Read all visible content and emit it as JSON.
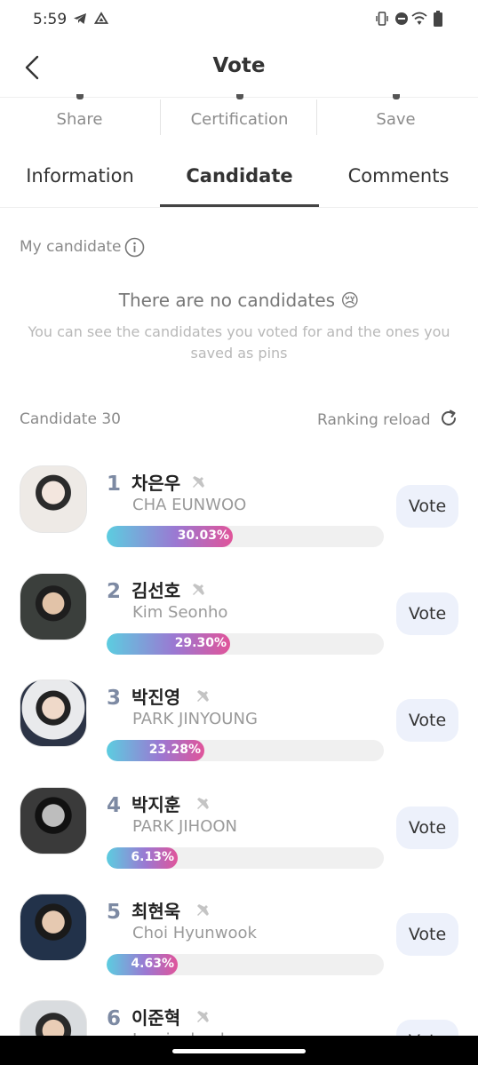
{
  "status_bar": {
    "time": "5:59"
  },
  "header": {
    "title": "Vote"
  },
  "actions": [
    {
      "label": "Share"
    },
    {
      "label": "Certification"
    },
    {
      "label": "Save"
    }
  ],
  "tabs": [
    {
      "label": "Information"
    },
    {
      "label": "Candidate"
    },
    {
      "label": "Comments"
    }
  ],
  "my_candidate": {
    "label": "My candidate",
    "empty_title": "There are no candidates 😢",
    "empty_desc": "You can see the candidates you voted for and the ones you saved as pins"
  },
  "list_header": {
    "count_label": "Candidate 30",
    "reload_label": "Ranking reload"
  },
  "vote_label": "Vote",
  "colors": {
    "bar_gradient_start": "#5ccde0",
    "bar_gradient_mid": "#9b78d2",
    "bar_gradient_end": "#e0549a",
    "vote_button_bg": "#edf1fb",
    "rank_color": "#7d8aa3"
  },
  "candidates": [
    {
      "rank": "1",
      "name_ko": "차은우",
      "name_en": "CHA EUNWOO",
      "percent_label": "30.03%",
      "percent": 30.03
    },
    {
      "rank": "2",
      "name_ko": "김선호",
      "name_en": "Kim Seonho",
      "percent_label": "29.30%",
      "percent": 29.3
    },
    {
      "rank": "3",
      "name_ko": "박진영",
      "name_en": "PARK JINYOUNG",
      "percent_label": "23.28%",
      "percent": 23.28
    },
    {
      "rank": "4",
      "name_ko": "박지훈",
      "name_en": "PARK JIHOON",
      "percent_label": "6.13%",
      "percent": 6.13
    },
    {
      "rank": "5",
      "name_ko": "최현욱",
      "name_en": "Choi Hyunwook",
      "percent_label": "4.63%",
      "percent": 4.63
    },
    {
      "rank": "6",
      "name_ko": "이준혁",
      "name_en": "Lee junhyuk",
      "percent_label": "",
      "percent": 0
    }
  ]
}
